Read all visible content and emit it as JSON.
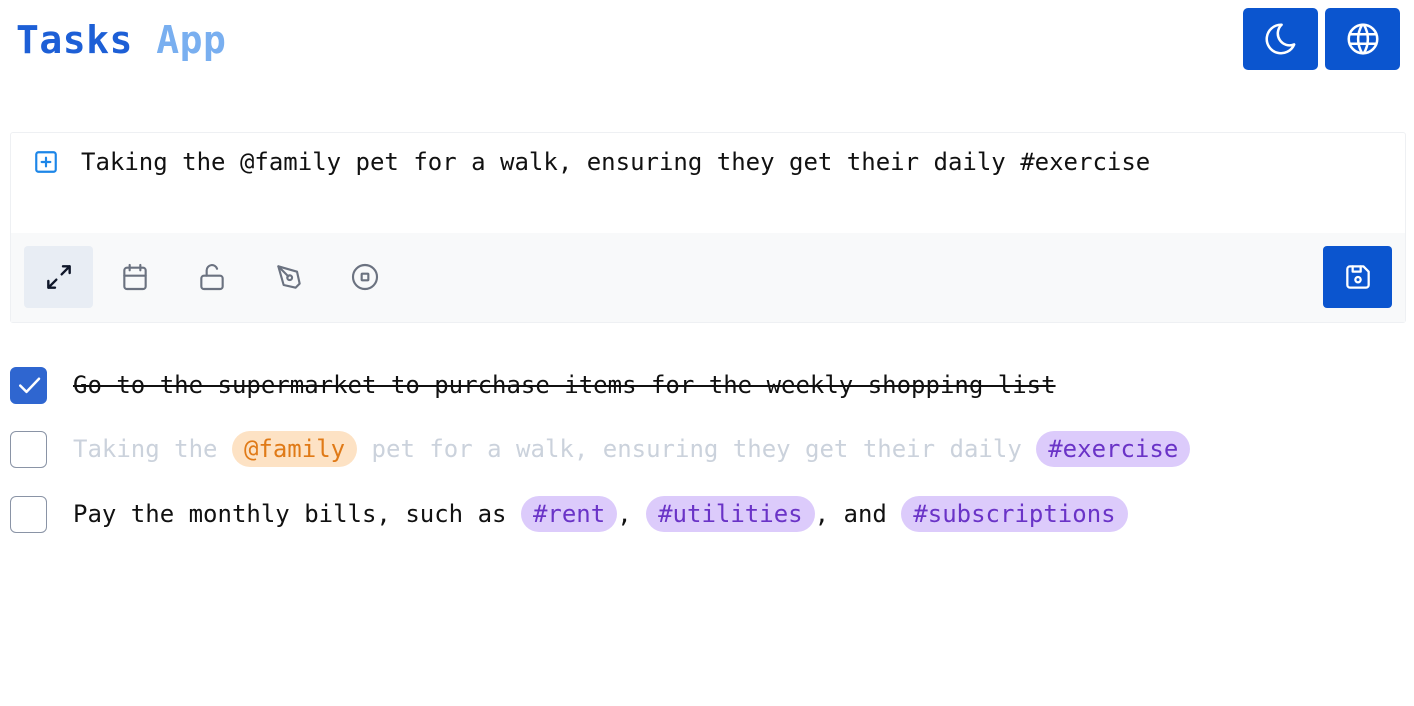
{
  "app": {
    "title_part1": "Tasks",
    "title_part2": "App"
  },
  "header": {
    "theme_icon": "moon-icon",
    "language_icon": "globe-icon"
  },
  "editor": {
    "value": "Taking the @family pet for a walk, ensuring they get their daily #exercise",
    "toolbar": [
      "expand-icon",
      "calendar-icon",
      "unlock-icon",
      "pen-tool-icon",
      "stop-circle-icon"
    ],
    "save_icon": "save-icon"
  },
  "tasks": [
    {
      "checked": true,
      "text": "Go to the supermarket to purchase items for the weekly shopping list"
    },
    {
      "checked": false,
      "seg0": "Taking the ",
      "mention": "@family",
      "seg1": " pet for a walk, ensuring they get their daily ",
      "tag": "#exercise"
    },
    {
      "checked": false,
      "seg0": "Pay the monthly bills, such as ",
      "tag0": "#rent",
      "sep0": ", ",
      "tag1": "#utilities",
      "sep1": ", and ",
      "tag2": "#subscriptions"
    }
  ],
  "colors": {
    "brand": "#0b55cf",
    "checkbox_checked": "#2f66d0",
    "mention_bg": "#fde2c4",
    "mention_fg": "#e07a17",
    "hashtag_bg": "#dccbfb",
    "hashtag_fg": "#6a33c7"
  }
}
